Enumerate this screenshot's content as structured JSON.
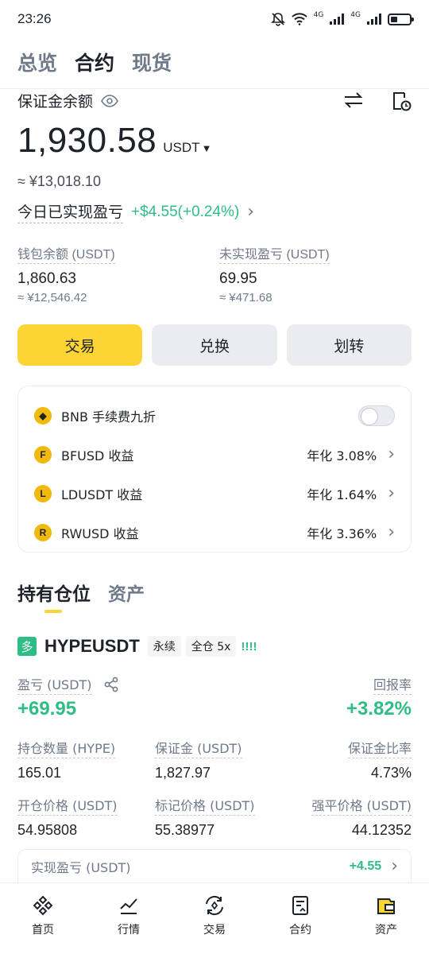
{
  "status_bar": {
    "time": "23:26",
    "net1": "4G",
    "net2": "4G"
  },
  "top_tabs": [
    {
      "label": "总览",
      "active": false
    },
    {
      "label": "合约",
      "active": true
    },
    {
      "label": "现货",
      "active": false
    }
  ],
  "account": {
    "margin_balance_label": "保证金余额",
    "balance": "1,930.58",
    "unit": "USDT",
    "approx_cny": "≈ ¥13,018.10",
    "today_pnl_label": "今日已实现盈亏",
    "today_pnl_value": "+$4.55(+0.24%)",
    "wallet_label": "钱包余额 (USDT)",
    "wallet_value": "1,860.63",
    "wallet_cny": "≈ ¥12,546.42",
    "unrealized_label": "未实现盈亏 (USDT)",
    "unrealized_value": "69.95",
    "unrealized_cny": "≈ ¥471.68"
  },
  "actions": {
    "trade": "交易",
    "convert": "兑换",
    "transfer": "划转"
  },
  "earn_card": {
    "bnb_label": "BNB 手续费九折",
    "bnb_enabled": false,
    "rows": [
      {
        "icon": "bfusd-coin-icon",
        "glyph": "F",
        "label": "BFUSD 收益",
        "rate": "年化 3.08%"
      },
      {
        "icon": "ldusdt-coin-icon",
        "glyph": "L",
        "label": "LDUSDT 收益",
        "rate": "年化 1.64%"
      },
      {
        "icon": "rwusd-coin-icon",
        "glyph": "R",
        "label": "RWUSD 收益",
        "rate": "年化 3.36%"
      }
    ]
  },
  "section_tabs": [
    {
      "label": "持有仓位",
      "active": true
    },
    {
      "label": "资产",
      "active": false
    }
  ],
  "position": {
    "side_badge": "多",
    "symbol": "HYPEUSDT",
    "contract_type": "永续",
    "margin_mode": "全仓 5x",
    "alert": "!!!!",
    "pnl_label": "盈亏 (USDT)",
    "pnl_value": "+69.95",
    "roe_label": "回报率",
    "roe_value": "+3.82%",
    "size_label": "持仓数量 (HYPE)",
    "size_value": "165.01",
    "margin_label": "保证金 (USDT)",
    "margin_value": "1,827.97",
    "margin_ratio_label": "保证金比率",
    "margin_ratio_value": "4.73%",
    "entry_label": "开仓价格 (USDT)",
    "entry_value": "54.95808",
    "mark_label": "标记价格 (USDT)",
    "mark_value": "55.38977",
    "liq_label": "强平价格 (USDT)",
    "liq_value": "44.12352",
    "realized_label": "实现盈亏 (USDT)",
    "realized_value": "+4.55"
  },
  "bottom_nav": [
    {
      "label": "首页",
      "icon": "home-icon",
      "active": false
    },
    {
      "label": "行情",
      "icon": "markets-icon",
      "active": false
    },
    {
      "label": "交易",
      "icon": "trade-icon",
      "active": false
    },
    {
      "label": "合约",
      "icon": "futures-icon",
      "active": false
    },
    {
      "label": "资产",
      "icon": "assets-icon",
      "active": true
    }
  ],
  "colors": {
    "accent": "#fcd535",
    "positive": "#2ebd85",
    "text": "#1e2329",
    "muted": "#707a8a"
  }
}
